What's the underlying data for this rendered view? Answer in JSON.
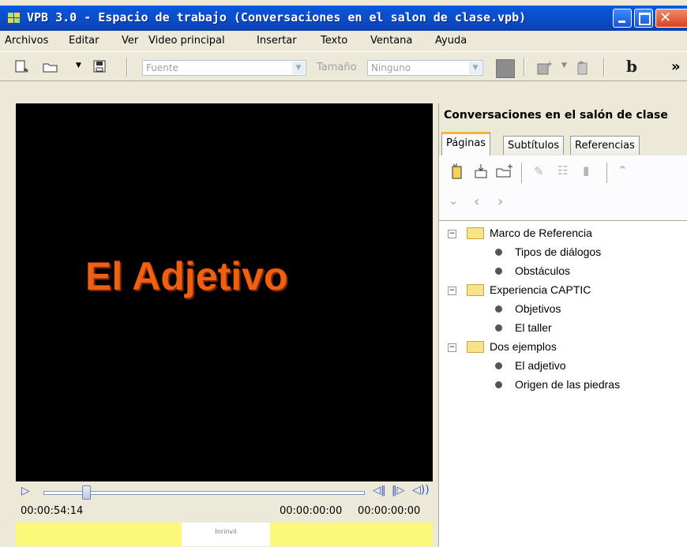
{
  "window": {
    "title": "VPB 3.0 - Espacio de trabajo (Conversaciones en el salon de clase.vpb)"
  },
  "menu": [
    "Archivos",
    "Editar",
    "Ver",
    "Video principal",
    "Insertar",
    "Texto",
    "Ventana",
    "Ayuda"
  ],
  "toolbar": {
    "font_value": "Fuente",
    "size_label": "Tamaño",
    "size_value": "Ninguno",
    "bold_label": "b",
    "overflow_label": "»"
  },
  "video": {
    "title_text": "El Adjetivo",
    "current_time": "00:00:54:14",
    "time_in": "00:00:00:00",
    "time_out": "00:00:00:00",
    "thumb_label": "Inrinvil"
  },
  "panel": {
    "title": "Conversaciones en el salón de clase",
    "tabs": [
      "Páginas",
      "Subtítulos",
      "Referencias"
    ],
    "active_tab": "Páginas"
  },
  "tree": [
    {
      "label": "Marco de Referencia",
      "children": [
        "Tipos de diálogos",
        "Obstáculos"
      ]
    },
    {
      "label": "Experiencia CAPTIC",
      "children": [
        "Objetivos",
        "El taller"
      ]
    },
    {
      "label": "Dos ejemplos",
      "children": [
        "El adjetivo",
        "Origen de las piedras"
      ]
    }
  ],
  "colors": {
    "titlebar": "#0A5EE8",
    "video_text": "#F0600E",
    "timeline": "#FCF97A",
    "tab_accent": "#F6B33F"
  }
}
